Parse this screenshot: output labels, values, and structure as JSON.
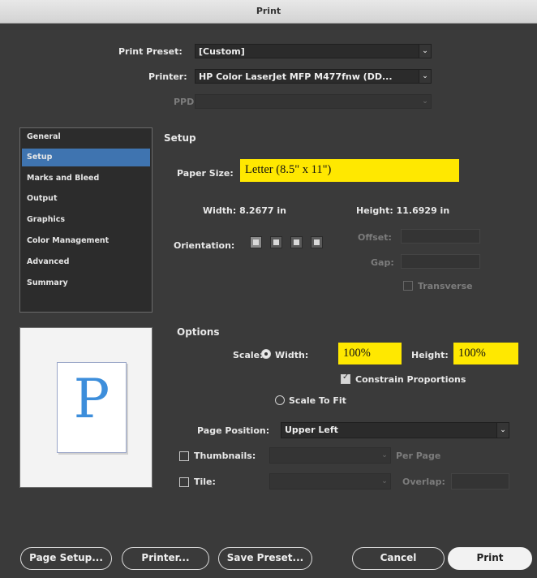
{
  "window": {
    "title": "Print"
  },
  "top": {
    "preset_label": "Print Preset:",
    "preset_value": "[Custom]",
    "printer_label": "Printer:",
    "printer_value": "HP Color LaserJet MFP M477fnw (DD...",
    "ppd_label": "PPD:",
    "ppd_value": ""
  },
  "sidebar": {
    "items": [
      {
        "label": "General"
      },
      {
        "label": "Setup"
      },
      {
        "label": "Marks and Bleed"
      },
      {
        "label": "Output"
      },
      {
        "label": "Graphics"
      },
      {
        "label": "Color Management"
      },
      {
        "label": "Advanced"
      },
      {
        "label": "Summary"
      }
    ],
    "selected": "Setup"
  },
  "preview": {
    "glyph": "P"
  },
  "setup": {
    "heading": "Setup",
    "paper_size_label": "Paper Size:",
    "paper_size_value": "Letter (8.5\" x 11\")",
    "width_label": "Width: 8.2677 in",
    "height_label": "Height: 11.6929 in",
    "orientation_label": "Orientation:",
    "offset_label": "Offset:",
    "gap_label": "Gap:",
    "transverse_label": "Transverse",
    "orientation_icons": [
      "portrait-icon",
      "landscape-icon",
      "reverse-portrait-icon",
      "reverse-landscape-icon"
    ]
  },
  "options": {
    "heading": "Options",
    "scale_label": "Scale:",
    "width_label": "Width:",
    "width_value": "100%",
    "height_label": "Height:",
    "height_value": "100%",
    "constrain_label": "Constrain Proportions",
    "scale_to_fit_label": "Scale To Fit",
    "page_position_label": "Page Position:",
    "page_position_value": "Upper Left",
    "thumbnails_label": "Thumbnails:",
    "per_page_label": "Per Page",
    "tile_label": "Tile:",
    "overlap_label": "Overlap:"
  },
  "buttons": {
    "page_setup": "Page Setup...",
    "printer": "Printer...",
    "save_preset": "Save Preset...",
    "cancel": "Cancel",
    "print": "Print"
  },
  "colors": {
    "highlight": "#ffe800",
    "selection": "#3f74b0",
    "preview_glyph": "#3d8edb"
  }
}
